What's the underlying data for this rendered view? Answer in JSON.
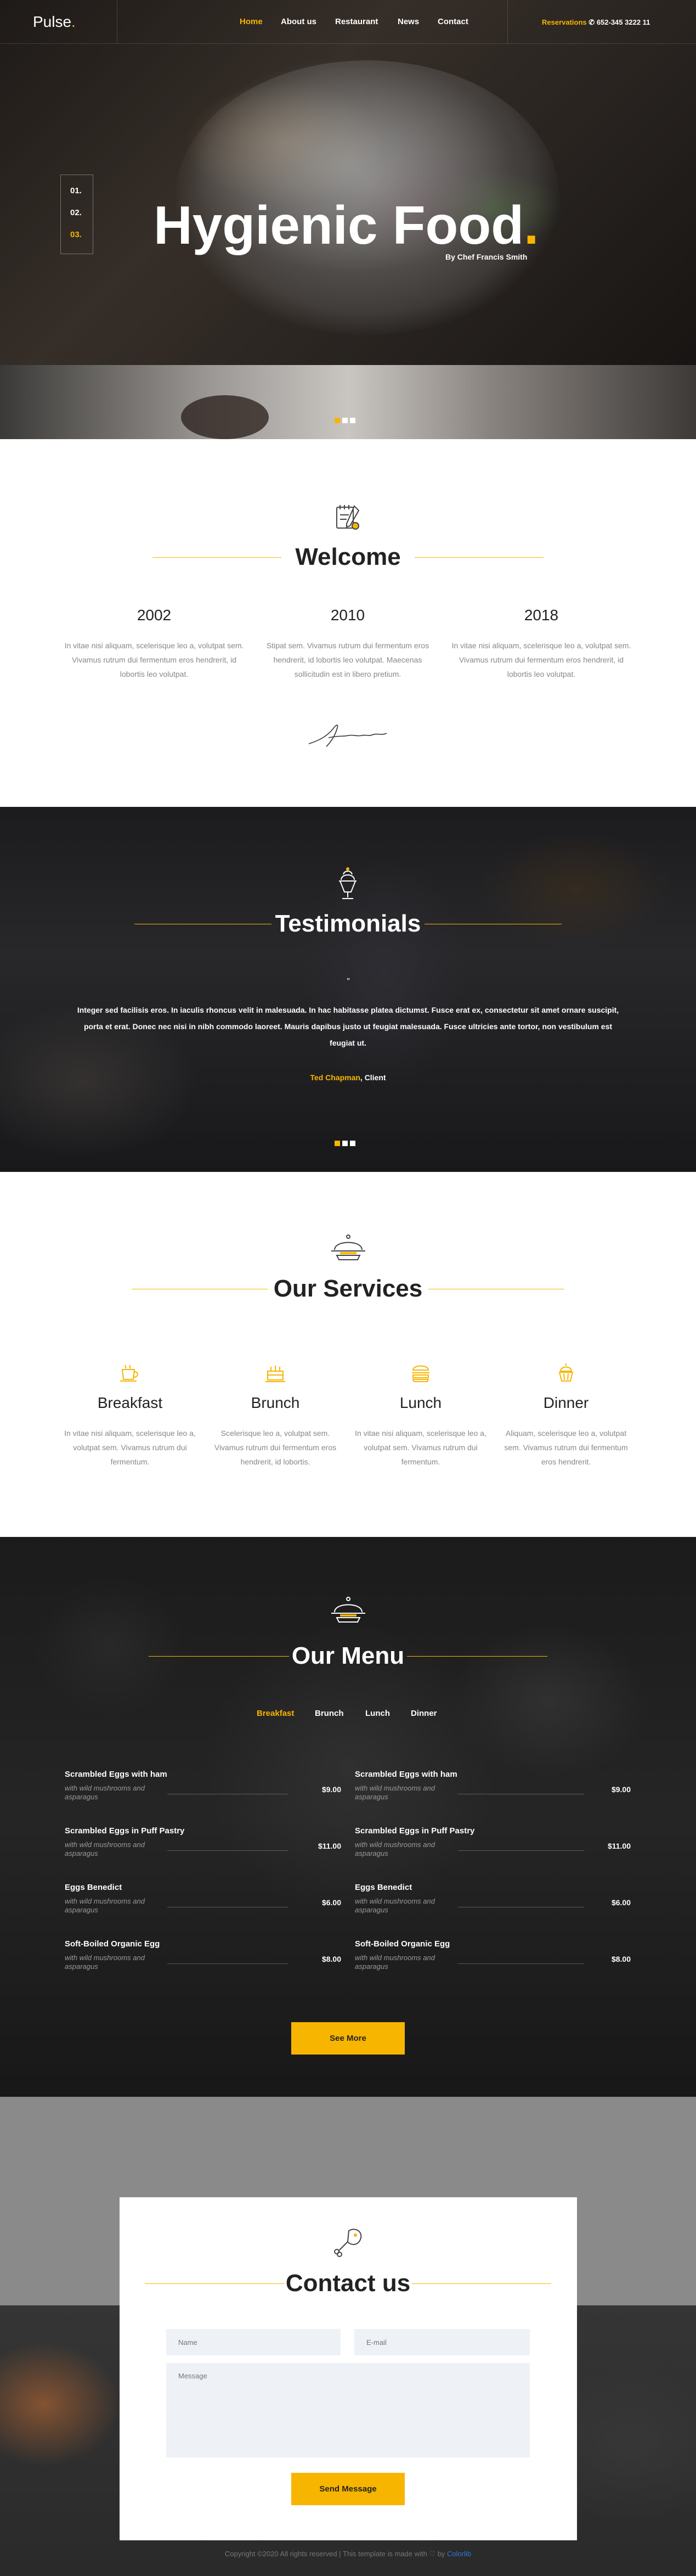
{
  "brand": {
    "name": "Pulse",
    "dot": "."
  },
  "nav": {
    "items": [
      "Home",
      "About us",
      "Restaurant",
      "News",
      "Contact"
    ],
    "active": "Home",
    "reservations_label": "Reservations",
    "phone": "652-345 3222 11"
  },
  "hero": {
    "slide_numbers": [
      "01.",
      "02.",
      "03."
    ],
    "active_slide": "03.",
    "title": "Hygienic Food",
    "title_dot": ".",
    "subtitle": "By Chef Francis Smith",
    "slides_total": 3,
    "slides_active_index": 0
  },
  "welcome": {
    "icon": "notepad-pencil-icon",
    "title": "Welcome",
    "columns": [
      {
        "year": "2002",
        "text": "In vitae nisi aliquam, scelerisque leo a, volutpat sem. Vivamus rutrum dui fermentum eros hendrerit, id lobortis leo volutpat."
      },
      {
        "year": "2010",
        "text": "Stipat sem. Vivamus rutrum dui fermentum eros hendrerit, id lobortis leo volutpat. Maecenas sollicitudin est in libero pretium."
      },
      {
        "year": "2018",
        "text": "In vitae nisi aliquam, scelerisque leo a, volutpat sem. Vivamus rutrum dui fermentum eros hendrerit, id lobortis leo volutpat."
      }
    ],
    "signature_icon": "signature"
  },
  "testimonials": {
    "icon": "ice-cream-cup-icon",
    "title": "Testimonials",
    "quote": "Integer sed facilisis eros. In iaculis rhoncus velit in malesuada. In hac habitasse platea dictumst. Fusce erat ex, consectetur sit amet ornare suscipit, porta et erat. Donec nec nisi in nibh commodo laoreet. Mauris dapibus justo ut feugiat malesuada. Fusce ultricies ante tortor, non vestibulum est feugiat ut.",
    "author_name": "Ted Chapman",
    "author_role": ", Client",
    "slides_total": 3,
    "slides_active_index": 0
  },
  "services": {
    "icon": "serving-dish-icon",
    "title": "Our Services",
    "items": [
      {
        "icon": "coffee-cup-icon",
        "title": "Breakfast",
        "text": "In vitae nisi aliquam, scelerisque leo a, volutpat sem. Vivamus rutrum dui fermentum."
      },
      {
        "icon": "cake-icon",
        "title": "Brunch",
        "text": "Scelerisque leo a, volutpat sem. Vivamus rutrum dui fermentum eros hendrerit, id lobortis."
      },
      {
        "icon": "burger-icon",
        "title": "Lunch",
        "text": "In vitae nisi aliquam, scelerisque leo a, volutpat sem. Vivamus rutrum dui fermentum."
      },
      {
        "icon": "cupcake-icon",
        "title": "Dinner",
        "text": "Aliquam, scelerisque leo a, volutpat sem. Vivamus rutrum dui fermentum eros hendrerit."
      }
    ]
  },
  "menu": {
    "icon": "serving-dish-icon",
    "title": "Our Menu",
    "tabs": [
      "Breakfast",
      "Brunch",
      "Lunch",
      "Dinner"
    ],
    "active_tab": "Breakfast",
    "left": [
      {
        "name": "Scrambled Eggs with ham",
        "desc": "with wild mushrooms and asparagus",
        "price": "$9.00"
      },
      {
        "name": "Scrambled Eggs in Puff Pastry",
        "desc": "with wild mushrooms and asparagus",
        "price": "$11.00"
      },
      {
        "name": "Eggs Benedict",
        "desc": "with wild mushrooms and asparagus",
        "price": "$6.00"
      },
      {
        "name": "Soft-Boiled Organic Egg",
        "desc": "with wild mushrooms and asparagus",
        "price": "$8.00"
      }
    ],
    "right": [
      {
        "name": "Scrambled Eggs with ham",
        "desc": "with wild mushrooms and asparagus",
        "price": "$9.00"
      },
      {
        "name": "Scrambled Eggs in Puff Pastry",
        "desc": "with wild mushrooms and asparagus",
        "price": "$11.00"
      },
      {
        "name": "Eggs Benedict",
        "desc": "with wild mushrooms and asparagus",
        "price": "$6.00"
      },
      {
        "name": "Soft-Boiled Organic Egg",
        "desc": "with wild mushrooms and asparagus",
        "price": "$8.00"
      }
    ],
    "see_more": "See More"
  },
  "contact": {
    "icon": "chicken-leg-icon",
    "title": "Contact us",
    "name_placeholder": "Name",
    "email_placeholder": "E-mail",
    "message_placeholder": "Message",
    "send_label": "Send Message"
  },
  "footer": {
    "copyright": "Copyright ©2020 All rights reserved | This template is made with ♡ by ",
    "brand": "Colorlib"
  },
  "colors": {
    "accent": "#f7b500",
    "dark": "#222222",
    "muted": "#888888"
  }
}
